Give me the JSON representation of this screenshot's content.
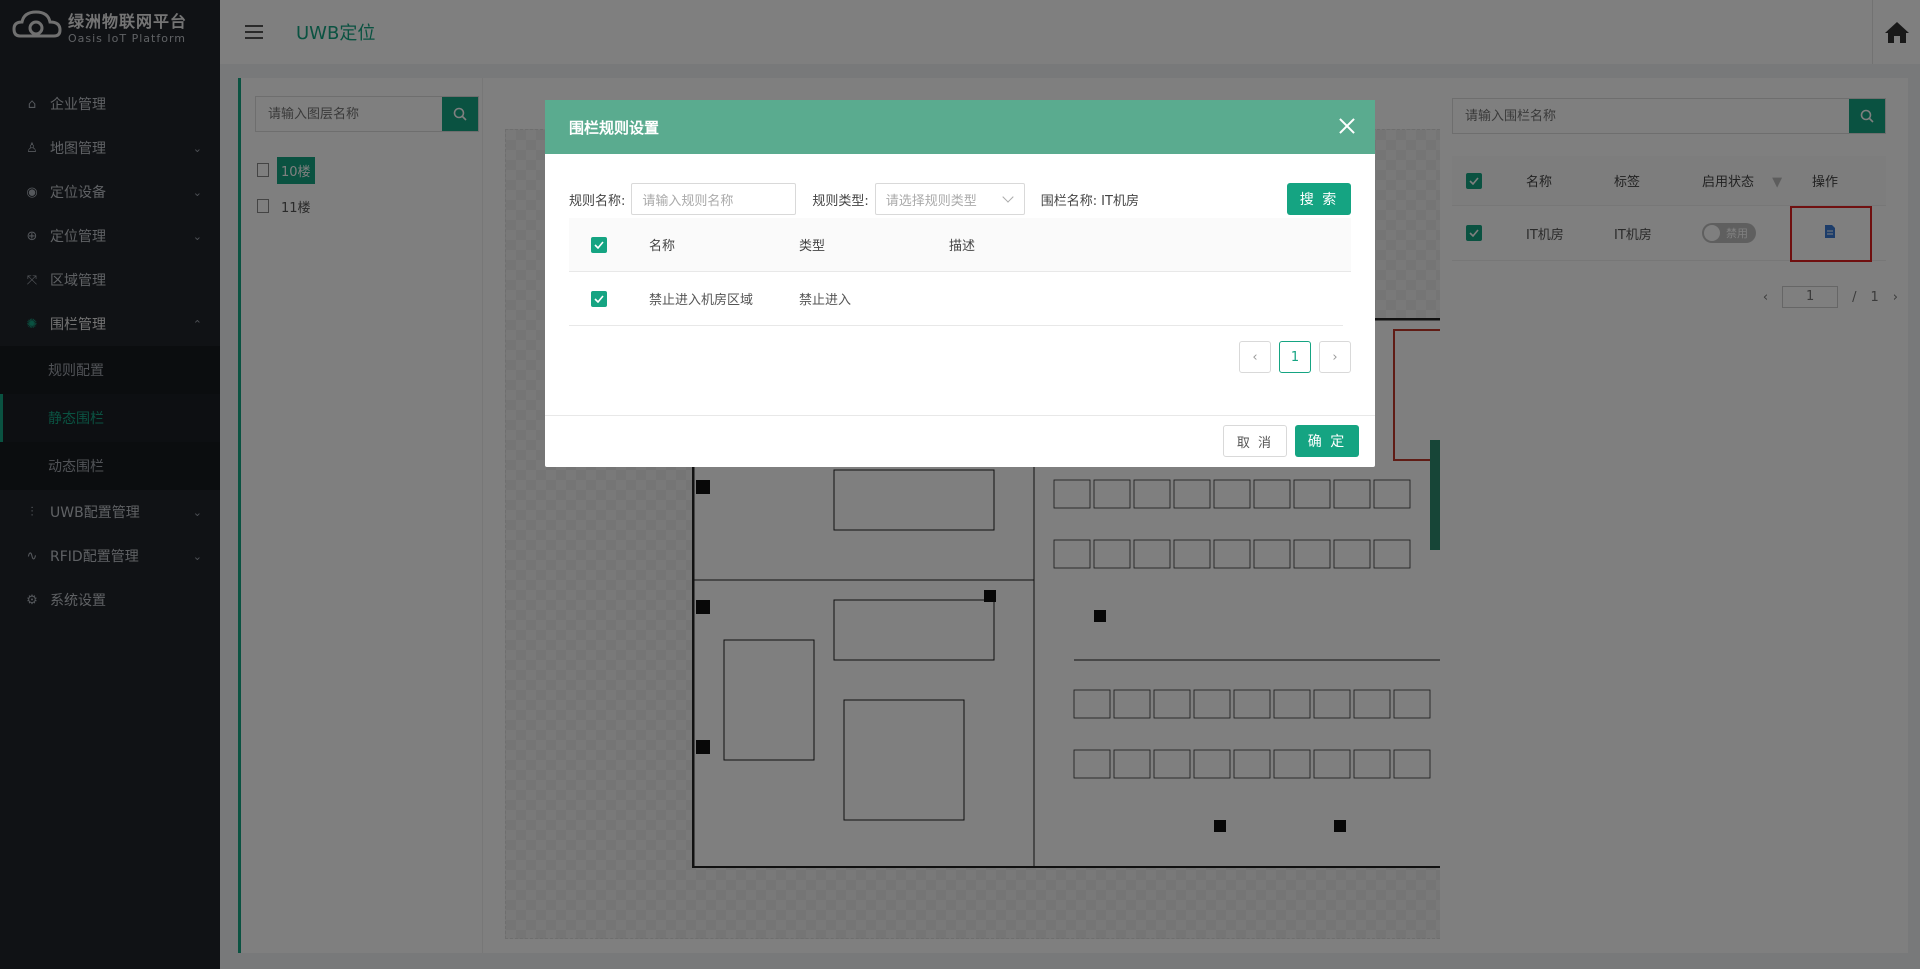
{
  "brand": {
    "name": "绿洲物联网平台",
    "subtitle": "Oasis IoT Platform",
    "accent": "#15a482"
  },
  "sidebar": {
    "items": [
      {
        "label": "企业管理",
        "icon": "enterprise-icon"
      },
      {
        "label": "地图管理",
        "icon": "map-icon"
      },
      {
        "label": "定位设备",
        "icon": "device-icon"
      },
      {
        "label": "定位管理",
        "icon": "location-icon"
      },
      {
        "label": "区域管理",
        "icon": "area-icon"
      },
      {
        "label": "围栏管理",
        "icon": "fence-icon",
        "expanded": true,
        "children": [
          {
            "label": "规则配置"
          },
          {
            "label": "静态围栏",
            "active": true
          },
          {
            "label": "动态围栏"
          }
        ]
      },
      {
        "label": "UWB配置管理",
        "icon": "sliders-icon"
      },
      {
        "label": "RFID配置管理",
        "icon": "rfid-icon"
      },
      {
        "label": "系统设置",
        "icon": "gear-icon"
      }
    ]
  },
  "header": {
    "title": "UWB定位"
  },
  "left_panel": {
    "search_placeholder": "请输入图层名称",
    "layers": [
      {
        "label": "10楼",
        "selected": true
      },
      {
        "label": "11楼"
      }
    ]
  },
  "right_panel": {
    "search_placeholder": "请输入围栏名称",
    "columns": [
      "名称",
      "标签",
      "启用状态",
      "操作"
    ],
    "rows": [
      {
        "name": "IT机房",
        "tag": "IT机房",
        "status": "禁用"
      }
    ],
    "pager": {
      "page": "1",
      "separator": "/",
      "total": "1"
    }
  },
  "modal": {
    "title": "围栏规则设置",
    "filters": {
      "rule_name_label": "规则名称:",
      "rule_name_placeholder": "请输入规则名称",
      "rule_type_label": "规则类型:",
      "rule_type_placeholder": "请选择规则类型",
      "fence_name_label": "围栏名称:",
      "fence_name_value": "IT机房",
      "search_button": "搜 索"
    },
    "columns": [
      "名称",
      "类型",
      "描述"
    ],
    "rows": [
      {
        "name": "禁止进入机房区域",
        "type": "禁止进入",
        "desc": ""
      }
    ],
    "pager": {
      "current": "1"
    },
    "cancel_button": "取 消",
    "confirm_button": "确 定"
  }
}
